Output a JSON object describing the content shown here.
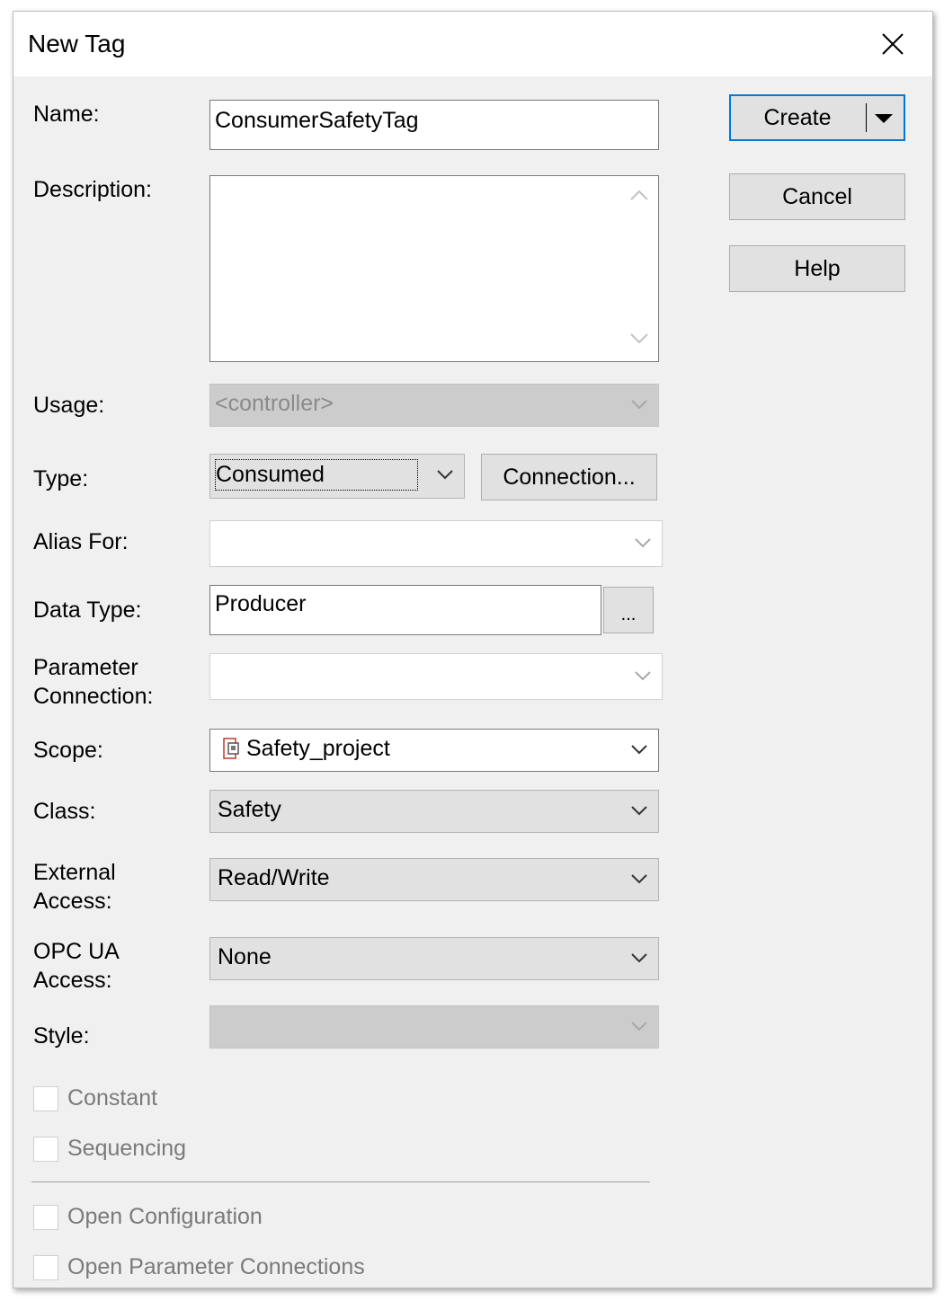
{
  "window": {
    "title": "New Tag"
  },
  "labels": {
    "name": "Name:",
    "description": "Description:",
    "usage": "Usage:",
    "type": "Type:",
    "alias_for": "Alias For:",
    "data_type": "Data Type:",
    "parameter_connection_1": "Parameter",
    "parameter_connection_2": "Connection:",
    "scope": "Scope:",
    "class": "Class:",
    "external_access_1": "External",
    "external_access_2": "Access:",
    "opc_ua_access_1": "OPC UA",
    "opc_ua_access_2": "Access:",
    "style": "Style:"
  },
  "fields": {
    "name_value": "ConsumerSafetyTag",
    "description_value": "",
    "usage_value": "<controller>",
    "type_value": "Consumed",
    "alias_for_value": "",
    "data_type_value": "Producer",
    "parameter_connection_value": "",
    "scope_value": "Safety_project",
    "class_value": "Safety",
    "external_access_value": "Read/Write",
    "opc_ua_access_value": "None",
    "style_value": ""
  },
  "buttons": {
    "create": "Create",
    "cancel": "Cancel",
    "help": "Help",
    "connection": "Connection...",
    "browse": "..."
  },
  "checkboxes": [
    {
      "label": "Constant",
      "checked": false,
      "enabled": false
    },
    {
      "label": "Sequencing",
      "checked": false,
      "enabled": false
    },
    {
      "label": "Open Configuration",
      "checked": false,
      "enabled": false
    },
    {
      "label": "Open Parameter Connections",
      "checked": false,
      "enabled": false
    }
  ],
  "icons": {
    "close": "close-icon",
    "dropdown": "chevron-down-icon",
    "split": "caret-down-icon",
    "scope": "controller-project-icon"
  },
  "colors": {
    "dialog_background": "#f0f0f0",
    "default_button_border": "#0078d7",
    "disabled_text": "#7a7a7a"
  }
}
